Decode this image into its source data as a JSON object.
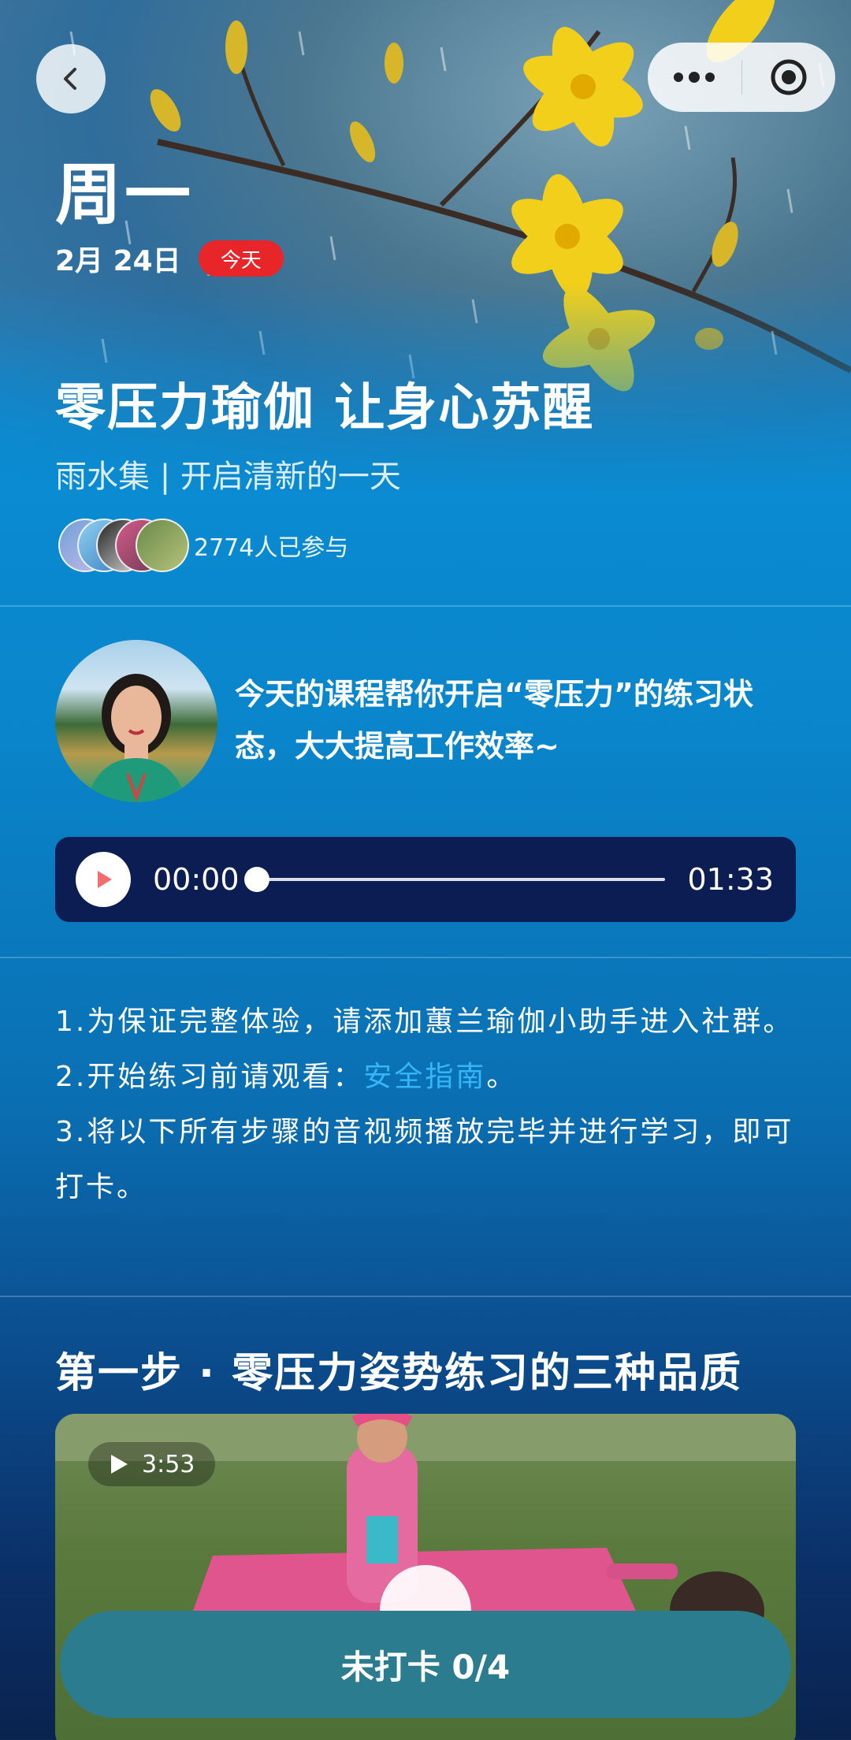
{
  "header": {
    "weekday": "周一",
    "date": "2月 24日",
    "today_badge": "今天"
  },
  "course": {
    "title": "零压力瑜伽 让身心苏醒",
    "subtitle": "雨水集 | 开启清新的一天",
    "participants": "2774人已参与"
  },
  "intro": {
    "text": "今天的课程帮你开启“零压力”的练习状态，大大提高工作效率~"
  },
  "audio": {
    "current_time": "00:00",
    "total_time": "01:33",
    "progress": 0
  },
  "rules": {
    "line1": "1.为保证完整体验，请添加蕙兰瑜伽小助手进入社群。",
    "line2_prefix": "2.开始练习前请观看：",
    "line2_link": "安全指南",
    "line2_suffix": "。",
    "line3": "3.将以下所有步骤的音视频播放完毕并进行学习，即可打卡。"
  },
  "step1": {
    "title": "第一步 · 零压力姿势练习的三种品质",
    "video_duration": "3:53"
  },
  "checkin": {
    "label": "未打卡 0/4"
  },
  "icons": {
    "back": "chevron-left-icon",
    "more": "more-dots-icon",
    "close": "target-close-icon",
    "play": "play-icon"
  },
  "colors": {
    "today_badge": "#e8262a",
    "link": "#35b6f6",
    "player_bg": "#0b1d52",
    "play_triangle": "#f26d6d",
    "checkin_bg": "#2c7c90"
  }
}
